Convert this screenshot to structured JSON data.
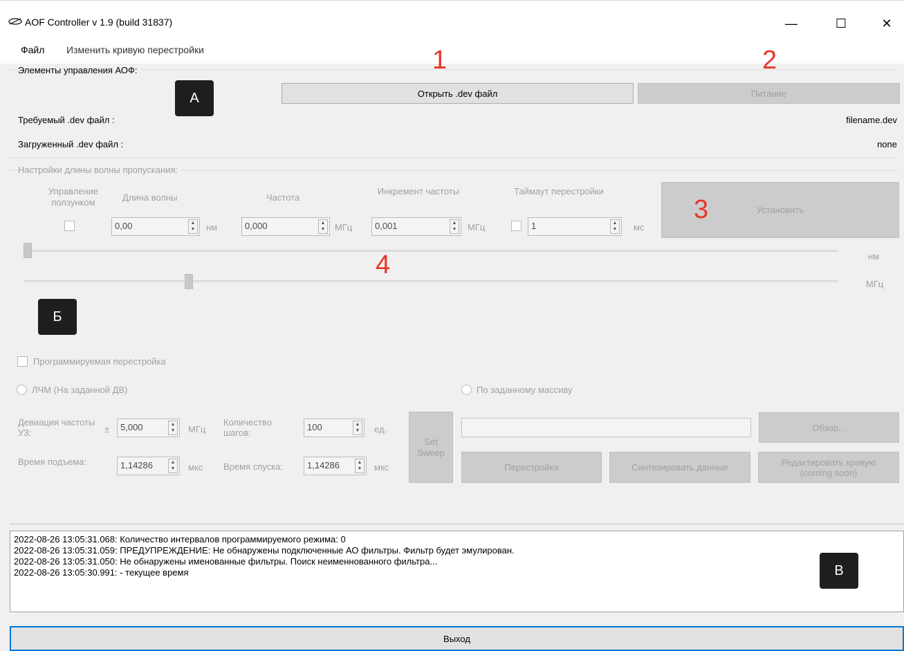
{
  "window": {
    "title": "AOF Controller v 1.9 (build 31837)",
    "minimize": "—",
    "maximize": "☐",
    "close": "✕"
  },
  "menu": {
    "file": "Файл",
    "edit_curve": "Изменить кривую перестройки"
  },
  "section_a": {
    "label": "Элементы управления АОФ:",
    "open_dev_button": "Открыть .dev файл",
    "power_button": "Питание",
    "required_label": "Требуемый .dev файл :",
    "required_value": "filename.dev",
    "loaded_label": "Загруженный .dev файл :",
    "loaded_value": "none"
  },
  "annotations": {
    "a": "А",
    "b": "Б",
    "v": "В",
    "n1": "1",
    "n2": "2",
    "n3": "3",
    "n4": "4"
  },
  "wavelength": {
    "group_label": "Настройки длины волны пропускания:",
    "slider_control_label": "Управление ползунком",
    "wavelength_label": "Длина волны",
    "wavelength_value": "0,00",
    "wavelength_unit": "нм",
    "frequency_label": "Частота",
    "frequency_value": "0,000",
    "frequency_unit": "МГц",
    "increment_label": "Инкремент частоты",
    "increment_value": "0,001",
    "increment_unit": "МГц",
    "timeout_label": "Таймаут перестройки",
    "timeout_value": "1",
    "timeout_unit": "мс",
    "set_button": "Установить",
    "slider_nm_unit": "нм",
    "slider_mhz_unit": "МГц",
    "slider_nm_level": 0.0,
    "slider_mhz_level": 0.2
  },
  "programmable": {
    "checkbox_label": "Программируемая перестройка",
    "lfm_radio": "ЛЧМ (На заданной ДВ)",
    "array_radio": "По заданному массиву",
    "deviation_label": "Девиация частоты УЗ:",
    "plus_minus": "±",
    "deviation_value": "5,000",
    "deviation_unit": "МГц",
    "steps_label": "Количество шагов:",
    "steps_value": "100",
    "steps_unit": "ед.",
    "rise_label": "Время подъема:",
    "rise_value": "1,14286",
    "rise_unit": "мкс",
    "fall_label": "Время спуска:",
    "fall_value": "1,14286",
    "fall_unit": "мкс",
    "set_sweep_button": "Set Sweep",
    "browse_button": "Обзор...",
    "retune_button": "Перестройка",
    "synth_button": "Синтезировать данные",
    "edit_curve_button": "Редактировать кривую (coming soon)"
  },
  "log": {
    "lines": [
      "2022-08-26 13:05:31.068: Количество интервалов программируемого режима: 0",
      "2022-08-26 13:05:31.059: ПРЕДУПРЕЖДЕНИЕ: Не обнаружены подключенные АО фильтры. Фильтр будет эмулирован.",
      "2022-08-26 13:05:31.050: Не обнаружены именованные фильтры. Поиск неименнованного фильтра...",
      "2022-08-26 13:05:30.991:  - текущее время"
    ]
  },
  "exit_button": "Выход"
}
